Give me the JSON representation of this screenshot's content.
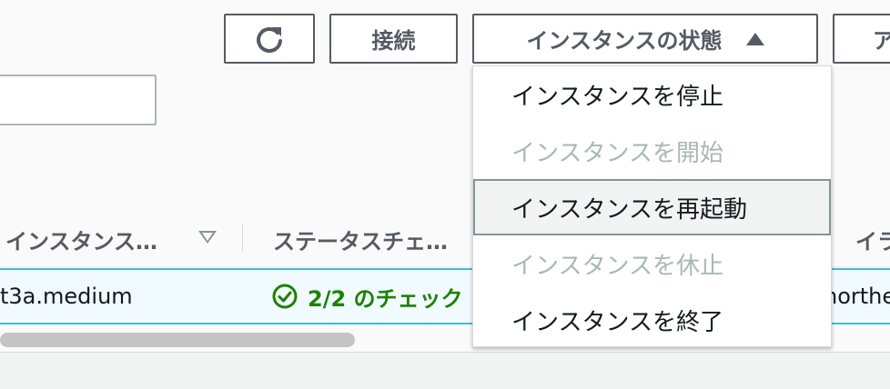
{
  "toolbar": {
    "connect_label": "接続",
    "instance_state_label": "インスタンスの状態",
    "actions_label_partial": "ア"
  },
  "search": {
    "value": ""
  },
  "table": {
    "headers": [
      "インスタンス…",
      "ステータスチェ…",
      "イラビ"
    ],
    "rows": [
      {
        "instance_type": "t3a.medium",
        "status_check": "2/2 のチェック",
        "az": "northe"
      }
    ]
  },
  "state_menu": {
    "items": [
      {
        "label": "インスタンスを停止",
        "enabled": true
      },
      {
        "label": "インスタンスを開始",
        "enabled": false
      },
      {
        "label": "インスタンスを再起動",
        "enabled": true,
        "highlighted": true
      },
      {
        "label": "インスタンスを休止",
        "enabled": false
      },
      {
        "label": "インスタンスを終了",
        "enabled": true
      }
    ]
  },
  "colors": {
    "success": "#1d8102",
    "selection_border": "#44b9d6",
    "button_text": "#545b64"
  },
  "icons": {
    "refresh": "refresh-icon",
    "sort": "sort-down-icon",
    "check": "check-circle-icon",
    "caret": "caret-up-icon"
  }
}
